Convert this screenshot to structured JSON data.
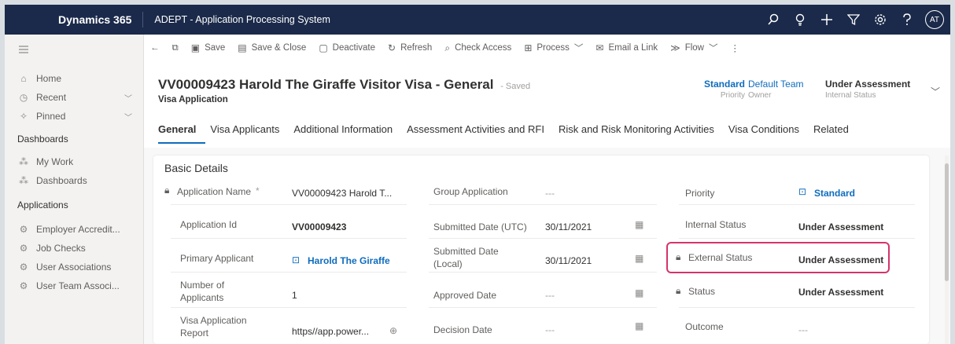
{
  "topbar": {
    "brand": "Dynamics 365",
    "app_title": "ADEPT - Application Processing System",
    "avatar": "AT"
  },
  "sidebar": {
    "items": [
      {
        "label": "Home",
        "icon": "home-icon"
      },
      {
        "label": "Recent",
        "icon": "clock-icon"
      },
      {
        "label": "Pinned",
        "icon": "pin-icon"
      }
    ],
    "dashboards_heading": "Dashboards",
    "dashboards": [
      {
        "label": "My Work",
        "icon": "grid-icon"
      },
      {
        "label": "Dashboards",
        "icon": "grid-icon"
      }
    ],
    "applications_heading": "Applications",
    "applications": [
      {
        "label": "Employer Accredit...",
        "icon": "entity-icon"
      },
      {
        "label": "Job Checks",
        "icon": "entity-icon"
      },
      {
        "label": "User Associations",
        "icon": "entity-icon"
      },
      {
        "label": "User Team Associ...",
        "icon": "entity-icon"
      }
    ]
  },
  "commands": {
    "save": "Save",
    "save_close": "Save & Close",
    "deactivate": "Deactivate",
    "refresh": "Refresh",
    "check_access": "Check Access",
    "process": "Process",
    "email_link": "Email a Link",
    "flow": "Flow"
  },
  "record": {
    "title": "VV00009423 Harold The Giraffe Visitor Visa - General",
    "saved": "- Saved",
    "type": "Visa Application",
    "header_fields": {
      "priority_value": "Standard",
      "priority_label": "Priority",
      "owner_value": "Default Team",
      "owner_label": "Owner",
      "internal_status_value": "Under Assessment",
      "internal_status_label": "Internal Status"
    }
  },
  "tabs": [
    "General",
    "Visa Applicants",
    "Additional Information",
    "Assessment Activities and RFI",
    "Risk and Risk Monitoring Activities",
    "Visa Conditions",
    "Related"
  ],
  "basic_details": {
    "section_title": "Basic Details",
    "col1": [
      {
        "label": "Application Name",
        "value": "VV00009423 Harold T..."
      },
      {
        "label": "Application Id",
        "value": "VV00009423"
      },
      {
        "label": "Primary Applicant",
        "value": "Harold The Giraffe"
      },
      {
        "label": "Number of Applicants",
        "value": "1"
      },
      {
        "label": "Visa Application Report",
        "value": "https//app.power..."
      }
    ],
    "col2": [
      {
        "label": "Group Application",
        "value": "---"
      },
      {
        "label": "Submitted Date (UTC)",
        "value": "30/11/2021"
      },
      {
        "label": "Submitted Date (Local)",
        "value": "30/11/2021"
      },
      {
        "label": "Approved Date",
        "value": "---"
      },
      {
        "label": "Decision Date",
        "value": "---"
      }
    ],
    "col3": [
      {
        "label": "Priority",
        "value": "Standard"
      },
      {
        "label": "Internal Status",
        "value": "Under Assessment"
      },
      {
        "label": "External Status",
        "value": "Under Assessment"
      },
      {
        "label": "Status",
        "value": "Under Assessment"
      },
      {
        "label": "Outcome",
        "value": "---"
      }
    ]
  },
  "colors": {
    "topbar": "#1b2a4a",
    "accent": "#0f6cbd",
    "highlight": "#d6336c"
  }
}
